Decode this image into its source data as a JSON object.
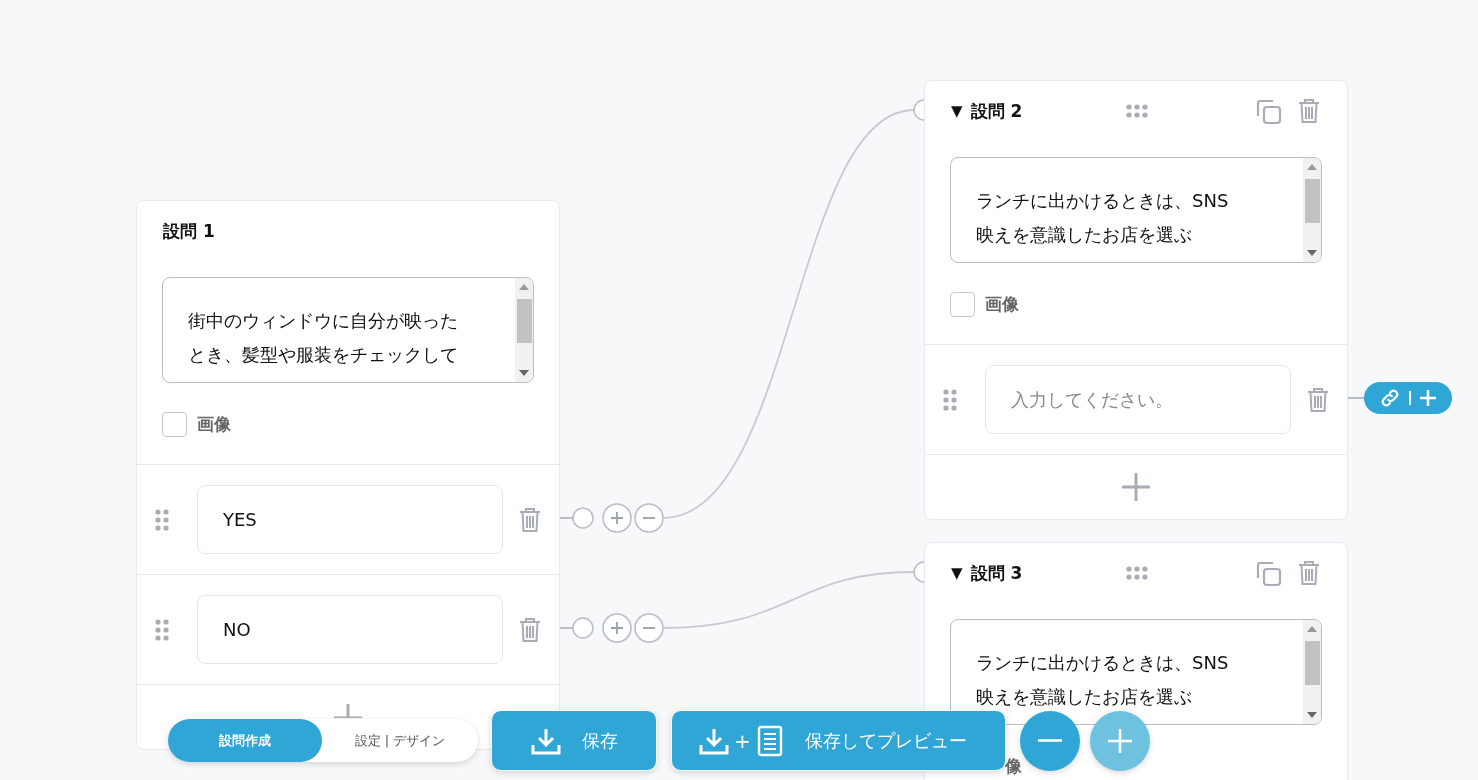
{
  "questions": [
    {
      "title": "設問 1",
      "text_lines": [
        "街中のウィンドウに自分が映った",
        "とき、髪型や服装をチェックして"
      ],
      "image": {
        "label": "画像",
        "checked": false
      },
      "options": [
        {
          "value": "YES",
          "linked": true
        },
        {
          "value": "NO",
          "linked": true
        }
      ]
    },
    {
      "toggle": "▼",
      "title": "設問 2",
      "text_lines": [
        "ランチに出かけるときは、SNS",
        "映えを意識したお店を選ぶ"
      ],
      "image": {
        "label": "画像",
        "checked": false
      },
      "options": [
        {
          "placeholder": "入力してください。",
          "linked": false
        }
      ]
    },
    {
      "toggle": "▼",
      "title": "設問 3",
      "text_lines": [
        "ランチに出かけるときは、SNS",
        "映えを意識したお店を選ぶ"
      ],
      "image": {
        "label": "像"
      }
    }
  ],
  "mode_tabs": [
    {
      "label": "設問作成",
      "selected": true
    },
    {
      "label": "設定 | デザイン",
      "selected": false
    }
  ],
  "save_button": {
    "label": "保存"
  },
  "preview_button": {
    "joiner": "+",
    "label": "保存してプレビュー"
  },
  "zoom_out": {
    "disabled": false
  },
  "zoom_in": {
    "disabled": true
  }
}
